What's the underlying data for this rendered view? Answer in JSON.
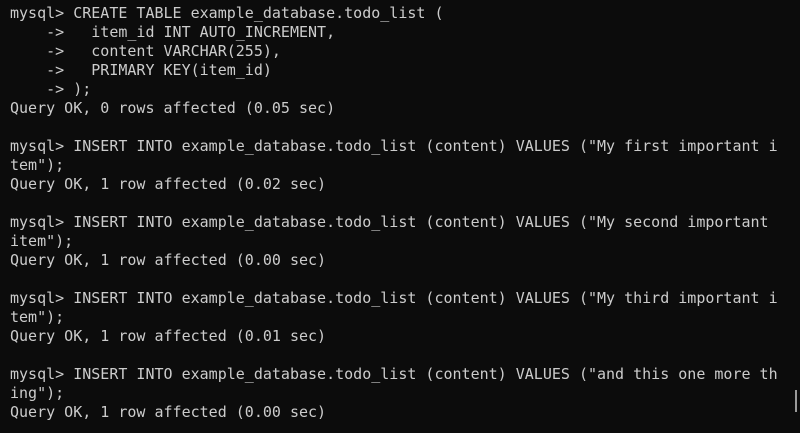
{
  "terminal": {
    "lines": [
      "mysql> CREATE TABLE example_database.todo_list (",
      "    ->   item_id INT AUTO_INCREMENT,",
      "    ->   content VARCHAR(255),",
      "    ->   PRIMARY KEY(item_id)",
      "    -> );",
      "Query OK, 0 rows affected (0.05 sec)",
      "",
      "mysql> INSERT INTO example_database.todo_list (content) VALUES (\"My first important i",
      "tem\");",
      "Query OK, 1 row affected (0.02 sec)",
      "",
      "mysql> INSERT INTO example_database.todo_list (content) VALUES (\"My second important",
      "item\");",
      "Query OK, 1 row affected (0.00 sec)",
      "",
      "mysql> INSERT INTO example_database.todo_list (content) VALUES (\"My third important i",
      "tem\");",
      "Query OK, 1 row affected (0.01 sec)",
      "",
      "mysql> INSERT INTO example_database.todo_list (content) VALUES (\"and this one more th",
      "ing\");",
      "Query OK, 1 row affected (0.00 sec)"
    ]
  },
  "scrollbar": {
    "position_fraction": 0.95,
    "visible_fraction": 0.05
  },
  "colors": {
    "background": "#0c0c0c",
    "foreground": "#cccccc",
    "scrollbar_thumb": "#9a9a9a"
  }
}
